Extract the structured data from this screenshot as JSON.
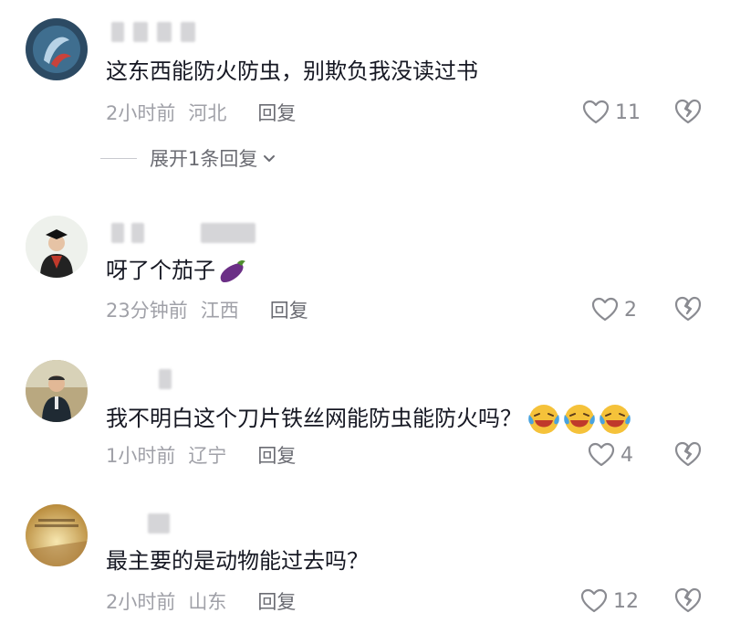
{
  "comments": [
    {
      "text": "这东西能防火防虫，别欺负我没读过书",
      "time": "2小时前",
      "location": "河北",
      "reply": "回复",
      "likes": "11",
      "expand": "展开1条回复"
    },
    {
      "text": "呀了个茄子",
      "time": "23分钟前",
      "location": "江西",
      "reply": "回复",
      "likes": "2"
    },
    {
      "text": "我不明白这个刀片铁丝网能防虫能防火吗？",
      "time": "1小时前",
      "location": "辽宁",
      "reply": "回复",
      "likes": "4"
    },
    {
      "text": "最主要的是动物能过去吗？",
      "time": "2小时前",
      "location": "山东",
      "reply": "回复",
      "likes": "12"
    }
  ],
  "icons": {
    "like": "heart-outline-icon",
    "dislike": "broken-heart-icon",
    "expand": "chevron-down-icon",
    "emoji_eggplant": "eggplant-emoji",
    "emoji_laugh": "laughing-crying-emoji"
  }
}
